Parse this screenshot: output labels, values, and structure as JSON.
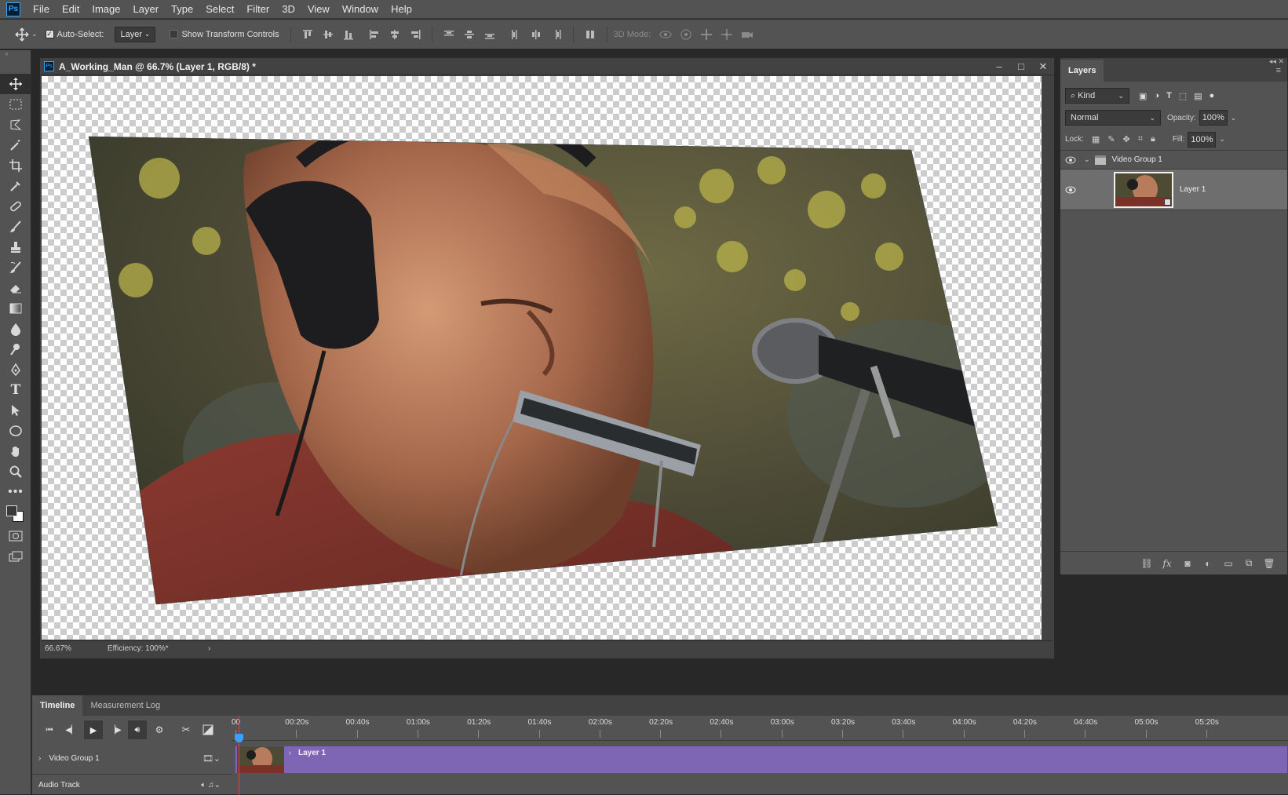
{
  "app": {
    "logo": "Ps"
  },
  "menu": [
    "File",
    "Edit",
    "Image",
    "Layer",
    "Type",
    "Select",
    "Filter",
    "3D",
    "View",
    "Window",
    "Help"
  ],
  "options": {
    "auto_select_label": "Auto-Select:",
    "auto_select_checked": true,
    "auto_select_value": "Layer",
    "show_transform_label": "Show Transform Controls",
    "show_transform_checked": false,
    "mode_3d_label": "3D Mode:"
  },
  "document": {
    "title": "A_Working_Man @ 66.7% (Layer 1, RGB/8) *",
    "zoom": "66.67%",
    "efficiency": "Efficiency: 100%*",
    "win_min": "–",
    "win_max": "□",
    "win_close": "✕"
  },
  "layers_panel": {
    "tab": "Layers",
    "kind_label": "Kind",
    "blend_mode": "Normal",
    "opacity_label": "Opacity:",
    "opacity_value": "100%",
    "lock_label": "Lock:",
    "fill_label": "Fill:",
    "fill_value": "100%",
    "group_name": "Video Group 1",
    "layer_name": "Layer 1"
  },
  "timeline": {
    "tabs": [
      "Timeline",
      "Measurement Log"
    ],
    "ruler": [
      "00",
      "00:20s",
      "00:40s",
      "01:00s",
      "01:20s",
      "01:40s",
      "02:00s",
      "02:20s",
      "02:40s",
      "03:00s",
      "03:20s",
      "03:40s",
      "04:00s",
      "04:20s",
      "04:40s",
      "05:00s",
      "05:20s"
    ],
    "track_video": "Video Group 1",
    "clip_label": "Layer 1",
    "track_audio": "Audio Track"
  },
  "colors": {
    "accent": "#31a8ff",
    "clip": "#7f66b4",
    "playhead": "#e83f3f"
  },
  "icons": [
    "move-icon",
    "marquee-icon",
    "lasso-icon",
    "magic-wand-icon",
    "crop-icon",
    "eyedropper-icon",
    "healing-brush-icon",
    "brush-icon",
    "clone-stamp-icon",
    "history-brush-icon",
    "eraser-icon",
    "gradient-icon",
    "blur-icon",
    "dodge-icon",
    "pen-icon",
    "type-icon",
    "path-select-icon",
    "ellipse-icon",
    "hand-icon",
    "zoom-icon",
    "more-tools-icon"
  ]
}
